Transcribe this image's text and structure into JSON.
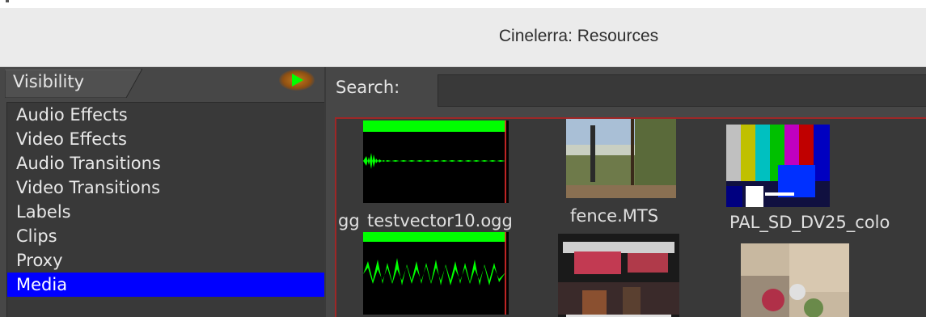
{
  "window": {
    "title": "Cinelerra: Resources"
  },
  "folder_panel": {
    "tab_label": "Visibility",
    "items": [
      {
        "label": "Audio Effects",
        "selected": false
      },
      {
        "label": "Video Effects",
        "selected": false
      },
      {
        "label": "Audio Transitions",
        "selected": false
      },
      {
        "label": "Video Transitions",
        "selected": false
      },
      {
        "label": "Labels",
        "selected": false
      },
      {
        "label": "Clips",
        "selected": false
      },
      {
        "label": "Proxy",
        "selected": false
      },
      {
        "label": "Media",
        "selected": true
      }
    ],
    "play_icon": "play-icon"
  },
  "search": {
    "label": "Search:",
    "value": ""
  },
  "media": {
    "items": [
      {
        "label": "gg",
        "kind": "audio"
      },
      {
        "label": "testvector10.ogg",
        "kind": "audio"
      },
      {
        "label": "fence.MTS",
        "kind": "video"
      },
      {
        "label": "PAL_SD_DV25_colo",
        "kind": "video"
      },
      {
        "label": "",
        "kind": "audio"
      },
      {
        "label": "",
        "kind": "video"
      },
      {
        "label": "",
        "kind": "video"
      }
    ]
  },
  "colors": {
    "selection": "#0000ff",
    "waveform": "#00ff00",
    "media_border": "#9e2727",
    "background": "#474747"
  }
}
